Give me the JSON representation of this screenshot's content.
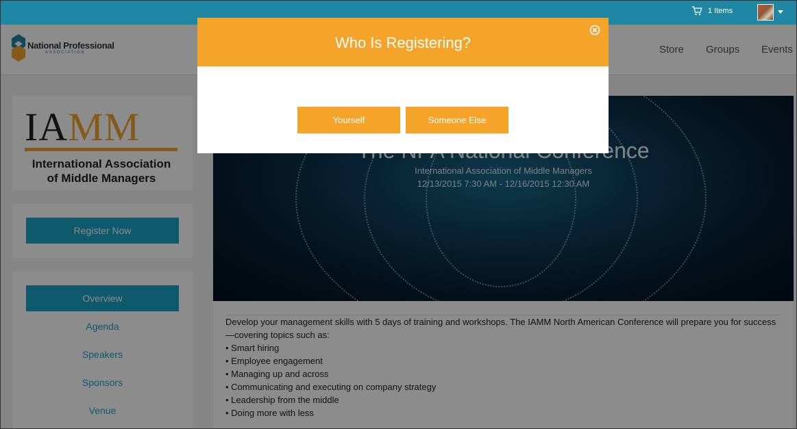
{
  "topbar": {
    "cart_label": "1 Items"
  },
  "header": {
    "logo_title": "National Professional",
    "logo_subtitle": "ASSOCIATION",
    "nav": [
      "Store",
      "Groups",
      "Events"
    ]
  },
  "sidebar": {
    "org_logo_letters": "IAMM",
    "org_logo_name_line1": "International Association",
    "org_logo_name_line2": "of Middle Managers",
    "register_label": "Register Now",
    "menu": [
      "Overview",
      "Agenda",
      "Speakers",
      "Sponsors",
      "Venue"
    ]
  },
  "event": {
    "title": "The NPA National Conference",
    "organizer": "International Association of Middle Managers",
    "dates": "12/13/2015 7:30 AM - 12/16/2015 12:30 AM",
    "intro": "Develop your management skills with 5 days of training and workshops. The IAMM North American Conference will prepare you for success—covering topics such as:",
    "bullets": [
      "• Smart hiring",
      "• Employee engagement",
      "• Managing up and across",
      "• Communicating and executing on company strategy",
      "• Leadership from the middle",
      "• Doing more with less"
    ]
  },
  "modal": {
    "title": "Who Is Registering?",
    "option_self": "Yourself",
    "option_other": "Someone Else"
  },
  "colors": {
    "topbar": "#1f86a3",
    "accent_blue": "#1ba3c5",
    "modal_orange": "#f5a42a",
    "iamm_gold": "#f0a22e"
  },
  "icons": {
    "cart": "cart-icon",
    "close": "close-icon",
    "caret": "caret-down-icon"
  }
}
